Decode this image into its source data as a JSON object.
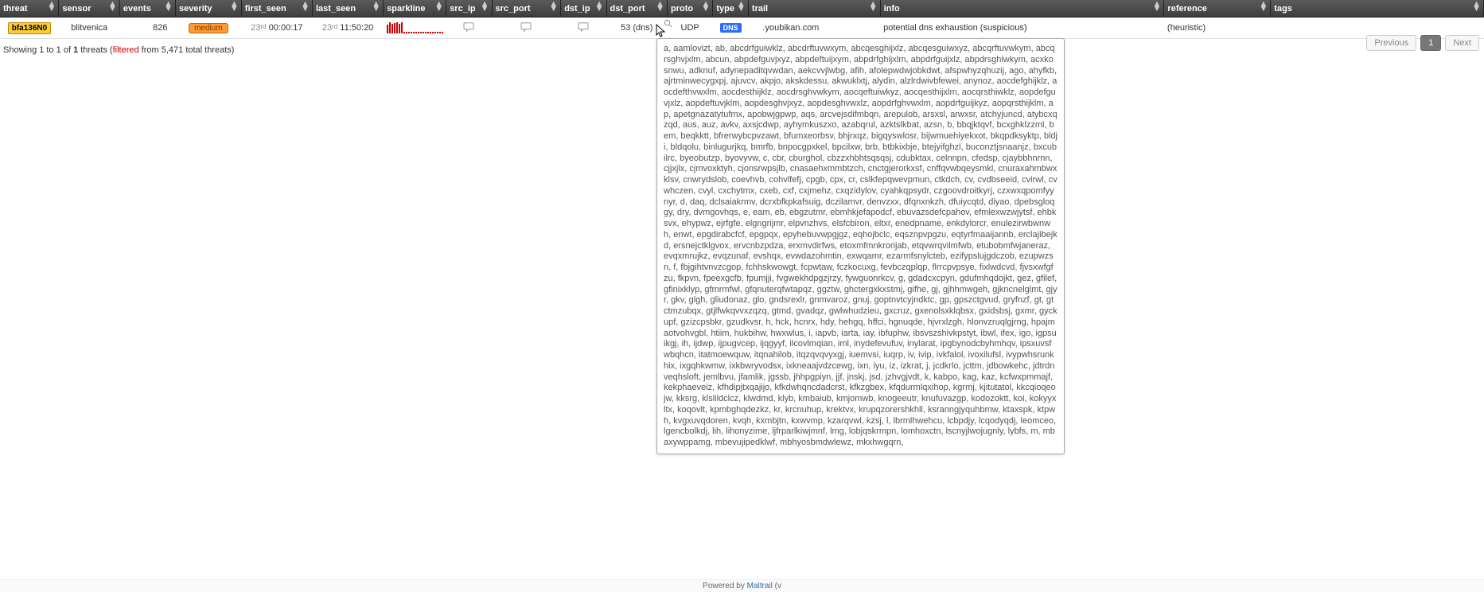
{
  "columns": [
    "threat",
    "sensor",
    "events",
    "severity",
    "first_seen",
    "last_seen",
    "sparkline",
    "src_ip",
    "src_port",
    "dst_ip",
    "dst_port",
    "proto",
    "type",
    "trail",
    "info",
    "reference",
    "tags"
  ],
  "row": {
    "threat_badge": "bfa136N0",
    "sensor": "blitvenica",
    "events": "826",
    "severity": "medium",
    "first_day": "23",
    "first_ord": "rd",
    "first_time": "00:00:17",
    "last_day": "23",
    "last_ord": "rd",
    "last_time": "11:50:20",
    "dst_port": "53 (dns)",
    "proto": "UDP",
    "type_badge": "DNS",
    "trail": ".youbikan.com",
    "info": "potential dns exhaustion (suspicious)",
    "reference": "(heuristic)",
    "tags": ""
  },
  "sparkline": [
    11,
    14,
    12,
    13,
    14,
    12,
    14,
    2,
    2,
    2,
    2,
    2,
    2,
    2,
    2,
    2,
    2,
    2,
    2,
    2,
    2,
    2,
    2,
    2
  ],
  "status": {
    "prefix": "Showing 1 to 1 of ",
    "bold": "1",
    "mid": " threats (",
    "filtered": "filtered",
    "suffix": " from 5,471 total threats)"
  },
  "pager": {
    "prev": "Previous",
    "page": "1",
    "next": "Next"
  },
  "tooltip": "a, aamlovizt, ab, abcdrfguiwklz, abcdrftuvwxym, abcqesghijxlz, abcqesguiwxyz, abcqrftuvwkym, abcqrsghvjxlm, abcun, abpdefguvjxyz, abpdeftuijxym, abpdrfghijxlm, abpdrfguijxlz, abpdrsghiwkym, acxkosnwu, adknuf, adynepaditqvwdan, aekcvvjlwbg, afih, afolepwdwjobkdwt, afspwhyzqhuzij, ago, ahyfkb, ajrtminwecygxpj, ajuvcv, akpjo, akskdessu, akwuklxtj, alydin, alzlrdwivbfewei, anynoz, aocdefghijklz, aocdefthvwxlm, aocdesthijklz, aocdrsghvwkym, aocqeftuiwkyz, aocqesthijxlm, aocqrsthiwklz, aopdefguvjxlz, aopdeftuvjklm, aopdesghvjxyz, aopdesghvwxlz, aopdrfghvwxlm, aopdrfguijkyz, aopqrsthijklm, ap, apetgnazatytufmx, apobwjgpwp, aqs, arcvejsdifmbqn, arepulob, arsxsl, arwxsr, atchyjuncd, atybcxqzqd, aus, auz, avkv, axsjcdwp, ayhymkuszxo, azabqrul, azktslkbat, azsn, b, bbqjktqvf, bcxghklzzml, bem, beqkktt, bfrerwybcpvzawt, bfumxeorbsv, bhjrxqz, bigqyswlosr, bijwmuehiyekxot, bkqpdksyktp, bldji, bldqolu, binlugurjkq, bmrfb, bnpocgpxkel, bpcilxw, brb, btbkixbje, btejyifghzl, buconztjsnaanjz, bxcubilrc, byeobutzp, byovyvw, c, cbr, cburghol, cbzzxhbhtsqsqsj, cdubktax, celnnpn, cfedsp, cjaybbhnrnn, cjjxjlx, cjmvoxktyh, cjonsrwpsjlb, cnasaehxmmbtzch, cnctgjerorkxsf, cnffqvwbqeysmkl, cnuraxahmbwxklsv, cnwrydslob, coevhvb, cohvlfefj, cpgb, cpx, cr, cslkfepqwevpmun, ctkdch, cv, cvdbseeid, cvirwl, cvwhczen, cvyl, cxchytmx, cxeb, cxf, cxjmehz, cxqzidylov, cyahkqpsydr, czgoovdroitkyrj, czxwxqpomfyynyr, d, daq, dclsaiakrmv, dcrxbfkpkafsuig, dczilamvr, denvzxx, dfqnxnkzh, dfuiycqtd, diyao, dpebsgloqgy, dry, dvmgovhqs, e, eam, eb, ebgzutmr, ebmhkjefapodcf, ebuvazsdefcpahov, efmlexwzwjytsf, ehbksvx, ehypwz, ejrfgfe, elgngrijmr, elpvnzhvs, elsfcbiron, eltxr, enedpname, enkdylorcr, enulezirwbwnwh, enwt, epgdirabcfcf, epgpqx, epyhebuvwpgjgz, eqhojbclc, eqsznpvpgzu, eqtyrfmaaijannb, erclajibejkd, ersnejctklgvox, ervcnbzpdza, erxmvdirfws, etoxmfmnkrorijab, etqvwrqvilmfwb, etubobmfwjaneraz, evqxmrujkz, evqzunaf, evshqx, evwdazohmtin, exwqamr, ezarmfsnylcteb, ezifypslujgdczob, ezupwzsn, f, fbjgihtvnvzcgop, fchhskwowgt, fcpwtaw, fczkocuxg, fevbczqplqp, flrrcpvpsye, fixlwdcvd, fjvsxwfgfzu, fkpvn, fpeexgcfb, fpumjji, fvgwekhdpgzjrzy, fywguonrkcv, g, gdadcxcpyn, gdufmhqdojkt, gez, gfilef, gfinixklyp, gfmrmfwl, gfqnuterqfwtapqz, ggztw, ghctergxkxstmj, gifhe, gj, gjhhmwgeh, gjkncnelglmt, gjyr, gkv, glgh, gliudonaz, glo, gndsrexlr, gnmvaroz, gnuj, goptnvtcyjndktc, gp, gpszctgvud, gryfnzf, gt, gtctmzubqx, gtjlfwkqvvxzqzq, gtmd, gvadqz, gwlwhudzieu, gxcruz, gxenolsxklqbsx, gxidsbsj, gxmr, gyckupf, gzizcpsbkr, gzudkvsr, h, hck, hcnrx, hdy, hehgq, hffci, hgnuqde, hjvrxlzgh, hlonvzruqlgjrng, hpajmaotvohvgbl, htiim, hukbihw, hwxwlus, i, iapvb, iarta, iay, ibfuphw, ibsvszshivkpstyt, ibwl, ifex, igo, igpsuikgj, ih, ijdwp, ijpugvcep, ijqgyyf, ilcovlmqian, iml, inydefevufuv, inylarat, ipgbynodcbyhmhqv, ipsxuvsfwbqhcn, itatmoewquw, itqnahilob, itqzqvqvyxgj, iuemvsi, iuqrp, iv, ivip, ivkfalol, ivoxilufsl, ivypwhsrunkhix, ixgqhkwmw, ixkbwryvodsx, ixkneaajvdzcewg, ixn, iyu, iz, izkrat, j, jcdkrlo, jcttm, jdbowkehc, jdtrdnveqhsloft, jemlbvu, jfamlik, jgssb, jhhpgpiyn, jjf, jnskj, jsd, jzhvgjvdt, k, kabpo, kag, kaz, kcfwxpmmajf, kekphaeveiz, kfhdipjtxqajijo, kfkdwhqncdadcrst, kfkzgbex, kfqdurmlqxihop, kgrmj, kjitutatol, kkcqioqeojw, kksrg, klslildclcz, klwdmd, klyb, kmbaiub, kmjomwb, knogeeutr, knufuvazgp, kodozoktt, koi, kokyyxltx, koqovlt, kpmbghqdezkz, kr, krcnuhup, krektvx, krupqzorershkhll, ksranngjyquhbmw, ktaxspk, ktpwh, kvgxuvqdoren, kvqh, kxmbjtn, kxwvmp, kzarqvwl, kzsj, l, lbrmlhwehcu, lcbpdjy, lcqodyqdj, leomceo, lgencbolkdj, lih, lihonyzime, ljfrparlkiwjmnf, lmg, lobjqskrmpn, lomhoxctn, lscnyjlwojugnly, lybfs, m, mbaxywppamg, mbevujipedklwf, mbhyosbmdwlewz, mkxhwgqrn,",
  "footer": {
    "pre": "Powered by ",
    "name": "Maltrail",
    "post": " (v"
  }
}
